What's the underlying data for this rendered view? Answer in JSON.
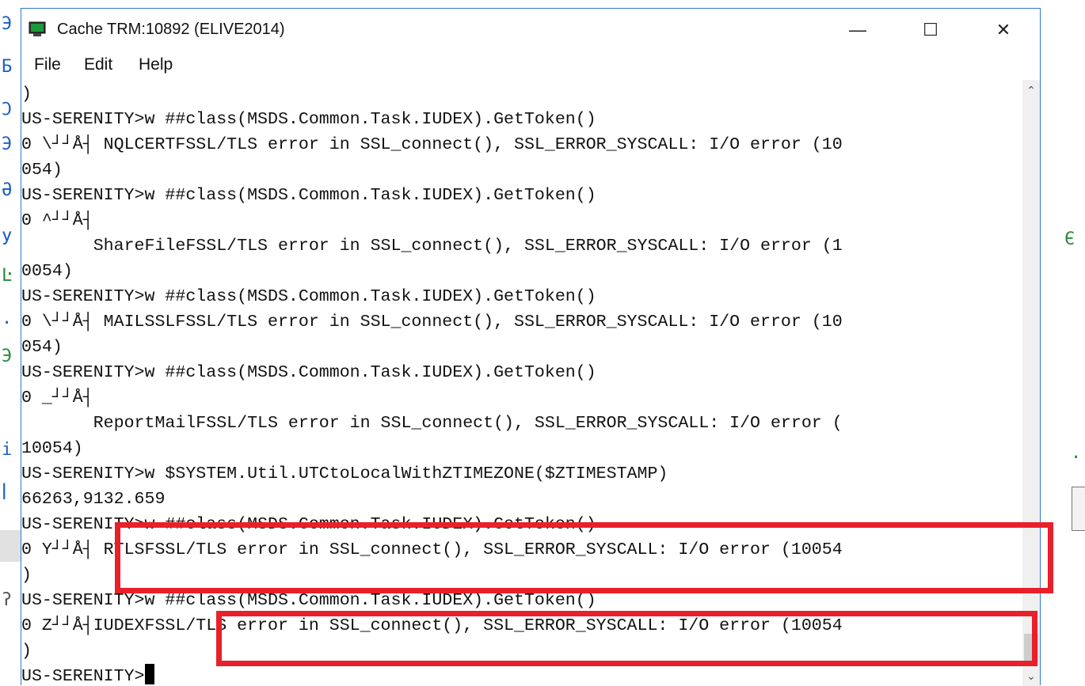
{
  "window": {
    "title": "Cache TRM:10892 (ELIVE2014)",
    "controls": {
      "minimize": "—",
      "maximize": "☐",
      "close": "✕"
    }
  },
  "menu": [
    "File",
    "Edit",
    "Help"
  ],
  "terminal": {
    "lines": [
      ")",
      "US-SERENITY>w ##class(MSDS.Common.Task.IUDEX).GetToken()",
      "0 \\┘┘Å┤ NQLCERTFSSL/TLS error in SSL_connect(), SSL_ERROR_SYSCALL: I/O error (10",
      "054)",
      "US-SERENITY>w ##class(MSDS.Common.Task.IUDEX).GetToken()",
      "0 ^┘┘Å┤",
      "       ShareFileFSSL/TLS error in SSL_connect(), SSL_ERROR_SYSCALL: I/O error (1",
      "0054)",
      "US-SERENITY>w ##class(MSDS.Common.Task.IUDEX).GetToken()",
      "0 \\┘┘Å┤ MAILSSLFSSL/TLS error in SSL_connect(), SSL_ERROR_SYSCALL: I/O error (10",
      "054)",
      "US-SERENITY>w ##class(MSDS.Common.Task.IUDEX).GetToken()",
      "0 _┘┘Å┤",
      "       ReportMailFSSL/TLS error in SSL_connect(), SSL_ERROR_SYSCALL: I/O error (",
      "10054)",
      "US-SERENITY>w $SYSTEM.Util.UTCtoLocalWithZTIMEZONE($ZTIMESTAMP)",
      "66263,9132.659",
      "US-SERENITY>w ##class(MSDS.Common.Task.IUDEX).GetToken()",
      "0 Y┘┘Å┤ RTLSFSSL/TLS error in SSL_connect(), SSL_ERROR_SYSCALL: I/O error (10054",
      ")",
      "US-SERENITY>w ##class(MSDS.Common.Task.IUDEX).GetToken()",
      "0 Z┘┘Å┤IUDEXFSSL/TLS error in SSL_connect(), SSL_ERROR_SYSCALL: I/O error (10054",
      ")"
    ],
    "prompt": "US-SERENITY>"
  },
  "background": {
    "left_fragments": [
      "Э",
      "Б",
      "Ͻ",
      "Э",
      "Ә",
      "У",
      "Ŀ",
      ".",
      "Э",
      "i",
      "ꟾ",
      "ʔ"
    ],
    "right_fragments": [
      "Є",
      "."
    ]
  },
  "colors": {
    "window_border": "#2b79d0",
    "highlight_box": "#e8202a",
    "background_text": "#1d5fc4"
  }
}
